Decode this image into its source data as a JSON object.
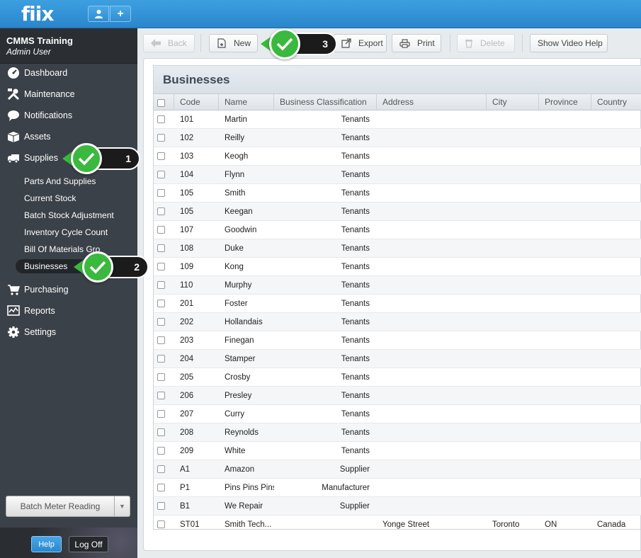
{
  "app": {
    "logo": "fiix",
    "add_label": "+"
  },
  "account": {
    "org": "CMMS Training",
    "role": "Admin User"
  },
  "nav": [
    {
      "label": "Dashboard",
      "icon": "dashboard-icon"
    },
    {
      "label": "Maintenance",
      "icon": "tools-icon"
    },
    {
      "label": "Notifications",
      "icon": "speech-bubble-icon"
    },
    {
      "label": "Assets",
      "icon": "box-icon"
    },
    {
      "label": "Supplies",
      "icon": "truck-icon"
    },
    {
      "label": "Purchasing",
      "icon": "cart-icon"
    },
    {
      "label": "Reports",
      "icon": "chart-icon"
    },
    {
      "label": "Settings",
      "icon": "gear-icon"
    }
  ],
  "supplies_sub": [
    "Parts And Supplies",
    "Current Stock",
    "Batch Stock Adjustment",
    "Inventory Cycle Count",
    "Bill Of Materials Gro",
    "Businesses"
  ],
  "batch": {
    "label": "Batch Meter Reading"
  },
  "footer": {
    "help": "Help",
    "logoff": "Log Off"
  },
  "toolbar": {
    "back": "Back",
    "new": "New",
    "export": "Export",
    "print": "Print",
    "delete": "Delete",
    "video_help": "Show Video Help"
  },
  "grid": {
    "title": "Businesses",
    "columns": [
      "Code",
      "Name",
      "Business Classification",
      "Address",
      "City",
      "Province",
      "Country"
    ],
    "rows": [
      [
        "101",
        "Martin",
        "Tenants",
        "",
        "",
        "",
        ""
      ],
      [
        "102",
        "Reilly",
        "Tenants",
        "",
        "",
        "",
        ""
      ],
      [
        "103",
        "Keogh",
        "Tenants",
        "",
        "",
        "",
        ""
      ],
      [
        "104",
        "Flynn",
        "Tenants",
        "",
        "",
        "",
        ""
      ],
      [
        "105",
        "Smith",
        "Tenants",
        "",
        "",
        "",
        ""
      ],
      [
        "105",
        "Keegan",
        "Tenants",
        "",
        "",
        "",
        ""
      ],
      [
        "107",
        "Goodwin",
        "Tenants",
        "",
        "",
        "",
        ""
      ],
      [
        "108",
        "Duke",
        "Tenants",
        "",
        "",
        "",
        ""
      ],
      [
        "109",
        "Kong",
        "Tenants",
        "",
        "",
        "",
        ""
      ],
      [
        "110",
        "Murphy",
        "Tenants",
        "",
        "",
        "",
        ""
      ],
      [
        "201",
        "Foster",
        "Tenants",
        "",
        "",
        "",
        ""
      ],
      [
        "202",
        "Hollandais",
        "Tenants",
        "",
        "",
        "",
        ""
      ],
      [
        "203",
        "Finegan",
        "Tenants",
        "",
        "",
        "",
        ""
      ],
      [
        "204",
        "Stamper",
        "Tenants",
        "",
        "",
        "",
        ""
      ],
      [
        "205",
        "Crosby",
        "Tenants",
        "",
        "",
        "",
        ""
      ],
      [
        "206",
        "Presley",
        "Tenants",
        "",
        "",
        "",
        ""
      ],
      [
        "207",
        "Curry",
        "Tenants",
        "",
        "",
        "",
        ""
      ],
      [
        "208",
        "Reynolds",
        "Tenants",
        "",
        "",
        "",
        ""
      ],
      [
        "209",
        "White",
        "Tenants",
        "",
        "",
        "",
        ""
      ],
      [
        "A1",
        "Amazon",
        "Supplier",
        "",
        "",
        "",
        ""
      ],
      [
        "P1",
        "Pins Pins Pins",
        "Manufacturer",
        "",
        "",
        "",
        ""
      ],
      [
        "B1",
        "We Repair",
        "Supplier",
        "",
        "",
        "",
        ""
      ],
      [
        "ST01",
        "Smith Tech...",
        "",
        "Yonge Street",
        "Toronto",
        "ON",
        "Canada"
      ]
    ]
  },
  "callouts": [
    "1",
    "2",
    "3"
  ],
  "colors": {
    "accent": "#2a86cc",
    "callout_green": "#3bb83e",
    "sidebar": "#3b4148"
  }
}
